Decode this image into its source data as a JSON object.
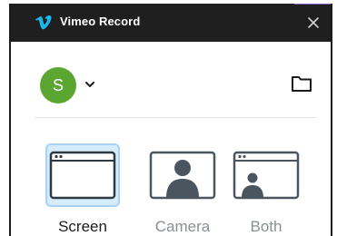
{
  "window": {
    "app_title": "Vimeo Record",
    "accent_color": "#1ab7ea"
  },
  "header": {
    "avatar_letter": "S",
    "avatar_color": "#5ba531",
    "account_menu_icon": "chevron-down-icon",
    "folder_icon": "folder-icon"
  },
  "modes": [
    {
      "label": "Screen",
      "icon": "screen-icon",
      "selected": true
    },
    {
      "label": "Camera",
      "icon": "camera-icon",
      "selected": false
    },
    {
      "label": "Both",
      "icon": "screen-and-camera-icon",
      "selected": false
    }
  ]
}
